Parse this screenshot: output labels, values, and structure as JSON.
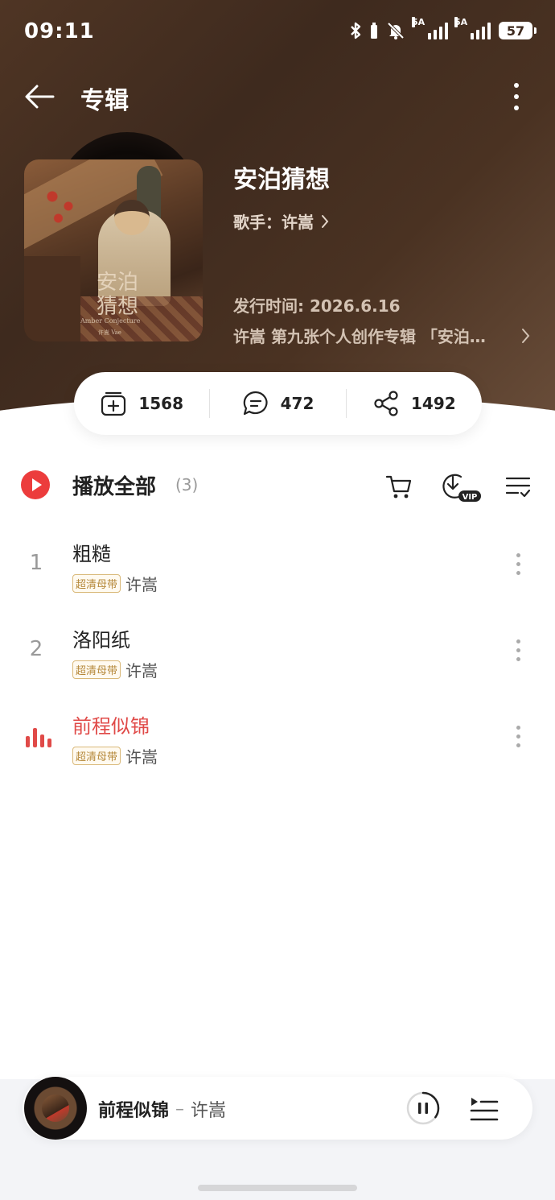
{
  "status_bar": {
    "time": "09:11",
    "signal_1_tag": "5A",
    "signal_2_tag": "5A",
    "battery": "57"
  },
  "nav": {
    "title": "专辑",
    "back_icon": "arrow-left-icon",
    "more_icon": "more-vertical-icon"
  },
  "album": {
    "title": "安泊猜想",
    "artist_label": "歌手：许嵩",
    "release": "发行时间: 2026.6.16",
    "description": "许嵩 第九张个人创作专辑 「安泊…",
    "cover_text": {
      "title_line1": "安泊",
      "title_line2": "猜想",
      "subtitle": "Amber Conjecture",
      "artist": "许嵩 Vae"
    }
  },
  "stats": {
    "collect": "1568",
    "comments": "472",
    "shares": "1492"
  },
  "play_all": {
    "label": "播放全部",
    "count": "(3)"
  },
  "tracks": [
    {
      "num": "1",
      "title": "粗糙",
      "badge": "超清母带",
      "artist": "许嵩",
      "playing": false
    },
    {
      "num": "2",
      "title": "洛阳纸",
      "badge": "超清母带",
      "artist": "许嵩",
      "playing": false
    },
    {
      "num": "",
      "title": "前程似锦",
      "badge": "超清母带",
      "artist": "许嵩",
      "playing": true
    }
  ],
  "mini_player": {
    "title": "前程似锦",
    "separator": "–",
    "artist": "许嵩",
    "progress": 0.35
  },
  "colors": {
    "accent": "#e04a48",
    "hero_bg": "#4f3524",
    "badge": "#b58839"
  }
}
